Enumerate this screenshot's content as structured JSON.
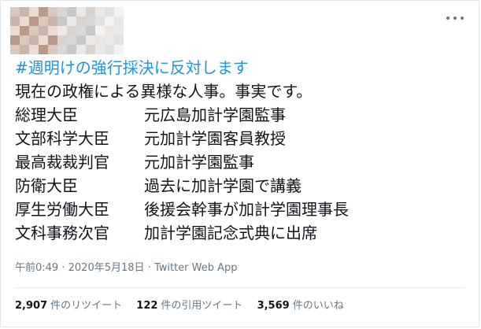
{
  "tweet": {
    "hashtag": "#週明けの強行採決に反対します",
    "intro": "現在の政権による異様な人事。事実です。",
    "roles": [
      {
        "title": "総理大臣",
        "connection": "元広島加計学園監事"
      },
      {
        "title": "文部科学大臣",
        "connection": "元加計学園客員教授"
      },
      {
        "title": "最高裁裁判官",
        "connection": "元加計学園監事"
      },
      {
        "title": "防衛大臣",
        "connection": "過去に加計学園で講義"
      },
      {
        "title": "厚生労働大臣",
        "connection": "後援会幹事が加計学園理事長"
      },
      {
        "title": "文科事務次官",
        "connection": "加計学園記念式典に出席"
      }
    ]
  },
  "meta": {
    "time": "午前0:49",
    "separator1": "·",
    "date": "2020年5月18日",
    "separator2": "·",
    "source": "Twitter Web App"
  },
  "stats": {
    "retweets": {
      "count": "2,907",
      "label": "件のリツイート"
    },
    "quotes": {
      "count": "122",
      "label": "件の引用ツイート"
    },
    "likes": {
      "count": "3,569",
      "label": "件のいいね"
    }
  },
  "colors": {
    "hashtag": "#1b95e0",
    "meta_text": "#657786",
    "avatar_blur": [
      "#d9c8bd",
      "#b89a8a",
      "#e8dcd4",
      "#c9b6aa",
      "#a58a7c",
      "#f0e8e2",
      "#dcd2cc",
      "#e9e9e9",
      "#c8c8c8",
      "#d7d7d7"
    ]
  },
  "icons": {
    "avatar": "blurred-avatar-mosaic",
    "more": "more-options-icon"
  }
}
